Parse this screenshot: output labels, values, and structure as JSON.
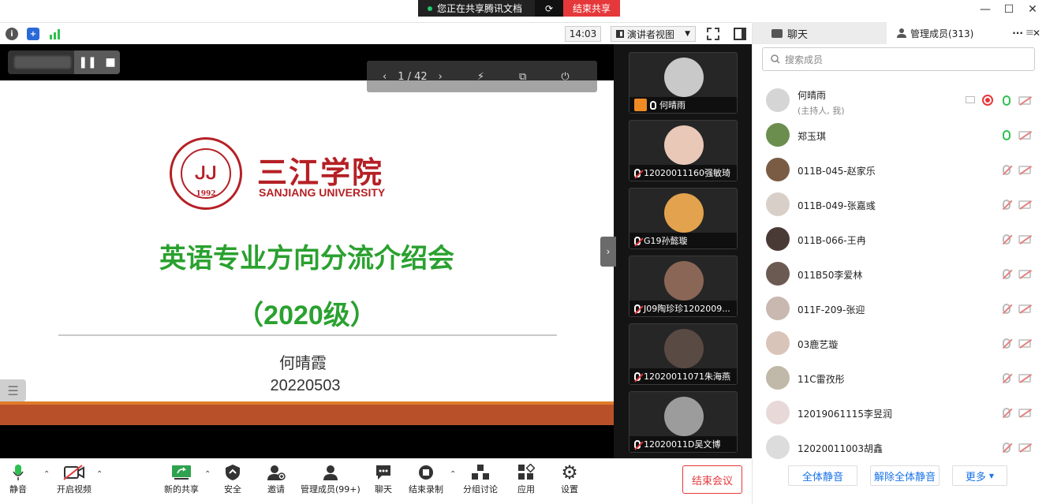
{
  "share_banner": {
    "status": "您正在共享腾讯文档",
    "end_share": "结束共享"
  },
  "toolbar": {
    "time": "14:03",
    "view_mode": "演讲者视图"
  },
  "slide": {
    "page": "1 / 42",
    "logo_cn": "三江学院",
    "logo_en": "SANJIANG UNIVERSITY",
    "seal_year": "1992",
    "title": "英语专业方向分流介绍会",
    "subtitle": "（2020级）",
    "presenter": "何晴霞",
    "date": "20220503"
  },
  "video_tiles": [
    {
      "name": "何晴雨",
      "color": "#c9c9c9"
    },
    {
      "name": "12020011160强敏琦",
      "color": "#e9c8b8"
    },
    {
      "name": "G19孙懿璇",
      "color": "#e3a24d"
    },
    {
      "name": "J09陶珍珍1202009...",
      "color": "#8a6656"
    },
    {
      "name": "12020011071朱海燕",
      "color": "#5a4a44"
    },
    {
      "name": "12020011D吴文博",
      "color": "#9c9c9c"
    }
  ],
  "bottom": {
    "mute": "静音",
    "video": "开启视频",
    "share": "新的共享",
    "security": "安全",
    "invite": "邀请",
    "members": "管理成员(99+)",
    "chat": "聊天",
    "record": "结束录制",
    "breakout": "分组讨论",
    "apps": "应用",
    "settings": "设置",
    "end_meeting": "结束会议"
  },
  "panel": {
    "tab_chat": "聊天",
    "tab_members": "管理成员(313)",
    "search_placeholder": "搜索成员",
    "members": [
      {
        "name": "何晴雨",
        "sub": "(主持人, 我)",
        "color": "#d5d5d5",
        "mic": "on"
      },
      {
        "name": "郑玉琪",
        "sub": "",
        "color": "#6b8e4e",
        "mic": "on"
      },
      {
        "name": "011B-045-赵家乐",
        "sub": "",
        "color": "#7a5c44",
        "mic": "off"
      },
      {
        "name": "011B-049-张嘉彧",
        "sub": "",
        "color": "#d8d0c8",
        "mic": "off"
      },
      {
        "name": "011B-066-王冉",
        "sub": "",
        "color": "#4a3a36",
        "mic": "off"
      },
      {
        "name": "011B50李爱林",
        "sub": "",
        "color": "#6a5a52",
        "mic": "off"
      },
      {
        "name": "011F-209-张迎",
        "sub": "",
        "color": "#c8b8b0",
        "mic": "off"
      },
      {
        "name": "03鹿艺璇",
        "sub": "",
        "color": "#d8c4b8",
        "mic": "off"
      },
      {
        "name": "11C雷孜彤",
        "sub": "",
        "color": "#c0b8a8",
        "mic": "off"
      },
      {
        "name": "12019061115李昱润",
        "sub": "",
        "color": "#e8d8d8",
        "mic": "off"
      },
      {
        "name": "12020011003胡鑫",
        "sub": "",
        "color": "#dcdcdc",
        "mic": "off"
      }
    ],
    "mute_all": "全体静音",
    "unmute_all": "解除全体静音",
    "more": "更多"
  }
}
